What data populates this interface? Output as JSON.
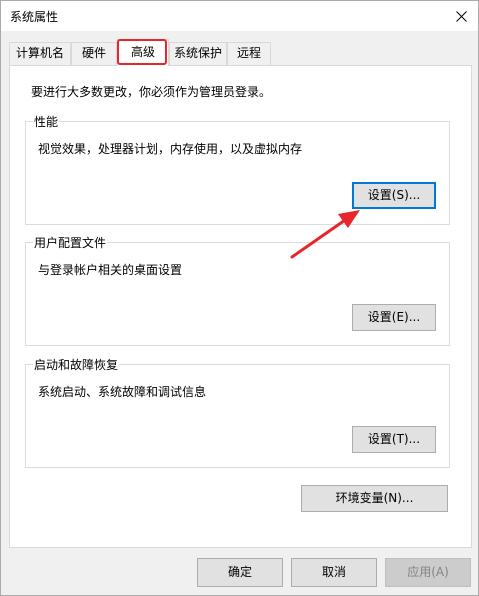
{
  "window": {
    "title": "系统属性"
  },
  "tabs": [
    {
      "label": "计算机名"
    },
    {
      "label": "硬件"
    },
    {
      "label": "高级"
    },
    {
      "label": "系统保护"
    },
    {
      "label": "远程"
    }
  ],
  "active_tab": "高级",
  "panel": {
    "intro": "要进行大多数更改，你必须作为管理员登录。",
    "performance": {
      "title": "性能",
      "desc": "视觉效果，处理器计划，内存使用，以及虚拟内存",
      "button": "设置(S)..."
    },
    "user_profiles": {
      "title": "用户配置文件",
      "desc": "与登录帐户相关的桌面设置",
      "button": "设置(E)..."
    },
    "startup_recovery": {
      "title": "启动和故障恢复",
      "desc": "系统启动、系统故障和调试信息",
      "button": "设置(T)..."
    },
    "env_button": "环境变量(N)..."
  },
  "footer": {
    "ok": "确定",
    "cancel": "取消",
    "apply": "应用(A)"
  },
  "colors": {
    "highlight": "#e6262a",
    "focus": "#0078d7"
  },
  "icons": {
    "close": "close-icon",
    "annotation": "red-arrow-annotation"
  }
}
